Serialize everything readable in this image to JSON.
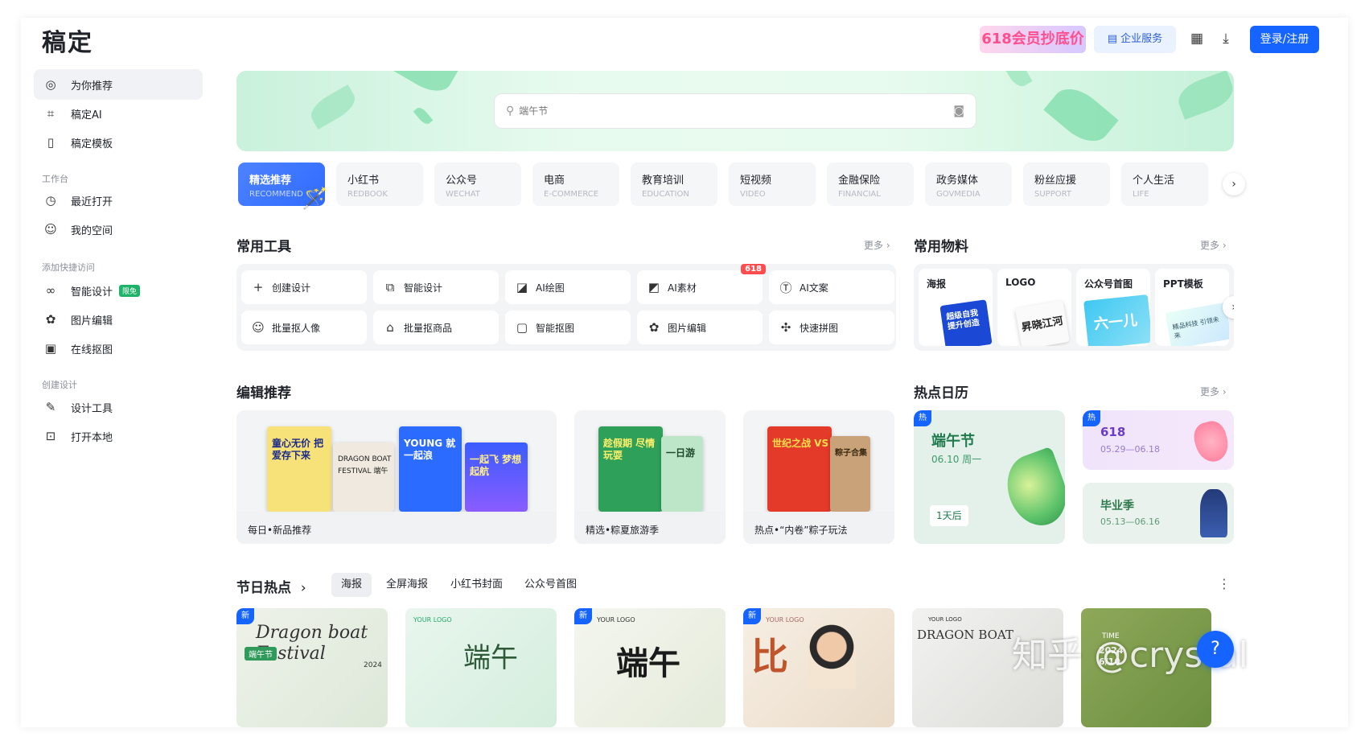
{
  "app": {
    "logo": "稿定"
  },
  "header": {
    "promo": "618会员抄底价",
    "enterprise": "企业服务",
    "login": "登录/注册"
  },
  "sidebar": {
    "items_top": [
      {
        "label": "为你推荐",
        "icon": "compass-icon"
      },
      {
        "label": "稿定AI",
        "icon": "ai-scan-icon"
      },
      {
        "label": "稿定模板",
        "icon": "template-icon"
      }
    ],
    "group_workspace": "工作台",
    "items_workspace": [
      {
        "label": "最近打开",
        "icon": "clock-icon"
      },
      {
        "label": "我的空间",
        "icon": "user-circle-icon"
      }
    ],
    "group_quick": "添加快捷访问",
    "items_quick": [
      {
        "label": "智能设计",
        "badge": "限免",
        "icon": "infinity-icon"
      },
      {
        "label": "图片编辑",
        "icon": "palette-icon"
      },
      {
        "label": "在线抠图",
        "icon": "cutout-icon"
      }
    ],
    "group_create": "创建设计",
    "items_create": [
      {
        "label": "设计工具",
        "icon": "pen-icon"
      },
      {
        "label": "打开本地",
        "icon": "folder-icon"
      }
    ]
  },
  "search": {
    "placeholder": "端午节"
  },
  "categories": [
    {
      "zh": "精选推荐",
      "en": "RECOMMEND"
    },
    {
      "zh": "小红书",
      "en": "REDBOOK"
    },
    {
      "zh": "公众号",
      "en": "WECHAT"
    },
    {
      "zh": "电商",
      "en": "E-COMMERCE"
    },
    {
      "zh": "教育培训",
      "en": "EDUCATION"
    },
    {
      "zh": "短视频",
      "en": "VIDEO"
    },
    {
      "zh": "金融保险",
      "en": "FINANCIAL"
    },
    {
      "zh": "政务媒体",
      "en": "GOVMEDIA"
    },
    {
      "zh": "粉丝应援",
      "en": "SUPPORT"
    },
    {
      "zh": "个人生活",
      "en": "LIFE"
    }
  ],
  "tools": {
    "title": "常用工具",
    "more": "更多 ›",
    "items": [
      {
        "label": "创建设计",
        "icon": "plus-icon"
      },
      {
        "label": "智能设计",
        "icon": "smart-design-icon"
      },
      {
        "label": "AI绘图",
        "icon": "ai-draw-icon"
      },
      {
        "label": "AI素材",
        "icon": "ai-material-icon",
        "tag": "618"
      },
      {
        "label": "AI文案",
        "icon": "ai-text-icon"
      },
      {
        "label": "批量抠人像",
        "icon": "portrait-cutout-icon"
      },
      {
        "label": "批量抠商品",
        "icon": "product-cutout-icon"
      },
      {
        "label": "智能抠图",
        "icon": "smart-cutout-icon"
      },
      {
        "label": "图片编辑",
        "icon": "image-edit-icon"
      },
      {
        "label": "快速拼图",
        "icon": "puzzle-icon"
      }
    ]
  },
  "materials": {
    "title": "常用物料",
    "more": "更多 ›",
    "items": [
      {
        "label": "海报",
        "art": "超级自我提升创造"
      },
      {
        "label": "LOGO",
        "art": "昇晓江河"
      },
      {
        "label": "公众号首图",
        "art": "六一儿"
      },
      {
        "label": "PPT模板",
        "art": "精品科技 引领未来"
      }
    ]
  },
  "editor": {
    "title": "编辑推荐",
    "picks": [
      {
        "label": "每日•新品推荐",
        "cards": [
          "童心无价 把爱存下来",
          "DRAGON BOAT FESTIVAL 端午",
          "YOUNG 就一起浪",
          "一起飞 梦想起航"
        ]
      },
      {
        "label": "精选•粽夏旅游季",
        "cards": [
          "趁假期 尽情玩耍",
          "一日游"
        ]
      },
      {
        "label": "热点•“内卷”粽子玩法",
        "cards": [
          "世纪之战 VS",
          "粽子合集"
        ]
      }
    ]
  },
  "calendar": {
    "title": "热点日历",
    "more": "更多 ›",
    "hot_badge": "热",
    "events": [
      {
        "name": "端午节",
        "date": "06.10 周一",
        "countdown": "1天后"
      },
      {
        "name": "618",
        "date": "05.29—06.18"
      },
      {
        "name": "毕业季",
        "date": "05.13—06.16"
      }
    ]
  },
  "festival": {
    "title": "节日热点",
    "tabs": [
      "海报",
      "全屏海报",
      "小红书封面",
      "公众号首图"
    ],
    "new_badge": "新",
    "cards": [
      {
        "text": "Dragon boat Festival",
        "sub": "端午节",
        "year": "2024"
      },
      {
        "text": "端午",
        "logo": "YOUR LOGO"
      },
      {
        "text": "端午",
        "logo": "YOUR LOGO"
      },
      {
        "text": "比",
        "logo": "YOUR LOGO"
      },
      {
        "text": "DRAGON BOAT",
        "logo": "YOUR LOGO"
      },
      {
        "text": "2024 6/10",
        "logo": "TIME"
      }
    ]
  },
  "watermark": "知乎 @crystal",
  "colors": {
    "primary": "#1664ff",
    "sidebar_active": "#f1f2f5"
  }
}
